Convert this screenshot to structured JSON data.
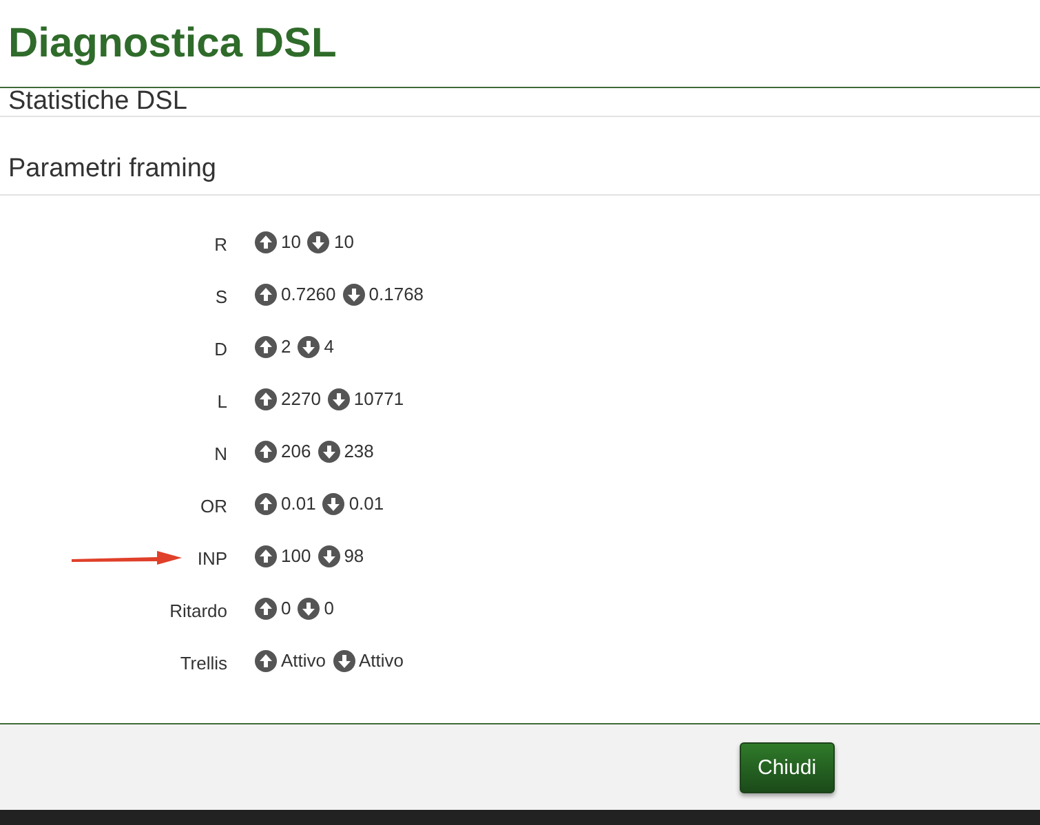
{
  "dialog": {
    "title": "Diagnostica DSL"
  },
  "sections": [
    {
      "title": "Statistiche DSL"
    },
    {
      "title": "Parametri framing"
    }
  ],
  "rows": [
    {
      "label": "R",
      "up": "10",
      "down": "10",
      "pointed": false
    },
    {
      "label": "S",
      "up": "0.7260",
      "down": "0.1768",
      "pointed": false
    },
    {
      "label": "D",
      "up": "2",
      "down": "4",
      "pointed": false
    },
    {
      "label": "L",
      "up": "2270",
      "down": "10771",
      "pointed": false
    },
    {
      "label": "N",
      "up": "206",
      "down": "238",
      "pointed": false
    },
    {
      "label": "OR",
      "up": "0.01",
      "down": "0.01",
      "pointed": false
    },
    {
      "label": "INP",
      "up": "100",
      "down": "98",
      "pointed": true
    },
    {
      "label": "Ritardo",
      "up": "0",
      "down": "0",
      "pointed": false
    },
    {
      "label": "Trellis",
      "up": "Attivo",
      "down": "Attivo",
      "pointed": false
    }
  ],
  "buttons": [
    {
      "label": "Chiudi"
    }
  ]
}
